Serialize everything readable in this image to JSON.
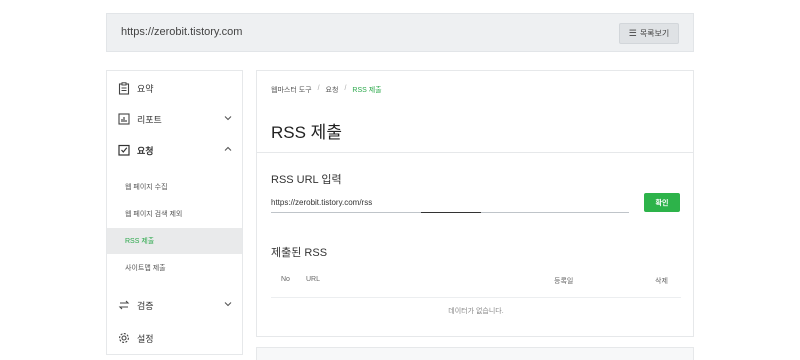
{
  "site": {
    "url": "https://zerobit.tistory.com",
    "list_button_label": "목록보기",
    "list_icon": "list-icon"
  },
  "sidebar": {
    "items": [
      {
        "label": "요약",
        "icon": "clipboard-icon"
      },
      {
        "label": "리포트",
        "icon": "chart-icon"
      },
      {
        "label": "요청",
        "icon": "checkbox-icon"
      },
      {
        "label": "검증",
        "icon": "swap-icon"
      },
      {
        "label": "설정",
        "icon": "gear-icon"
      }
    ],
    "sub_items": [
      {
        "label": "웹 페이지 수집"
      },
      {
        "label": "웹 페이지 검색 제외"
      },
      {
        "label": "RSS 제출"
      },
      {
        "label": "사이트맵 제출"
      }
    ]
  },
  "main": {
    "breadcrumb": [
      "웹마스터 도구",
      "요청",
      "RSS 제출"
    ],
    "title": "RSS 제출",
    "url_section_label": "RSS URL 입력",
    "url_value": "https://zerobit.tistory.com/rss",
    "confirm_label": "확인",
    "submitted_title": "제출된 RSS",
    "table_headers": [
      "No",
      "URL",
      "등록일",
      "삭제"
    ],
    "empty_message": "데이터가 없습니다."
  },
  "colors": {
    "accent": "#2db34a",
    "active_bg": "#e9eaeb"
  }
}
